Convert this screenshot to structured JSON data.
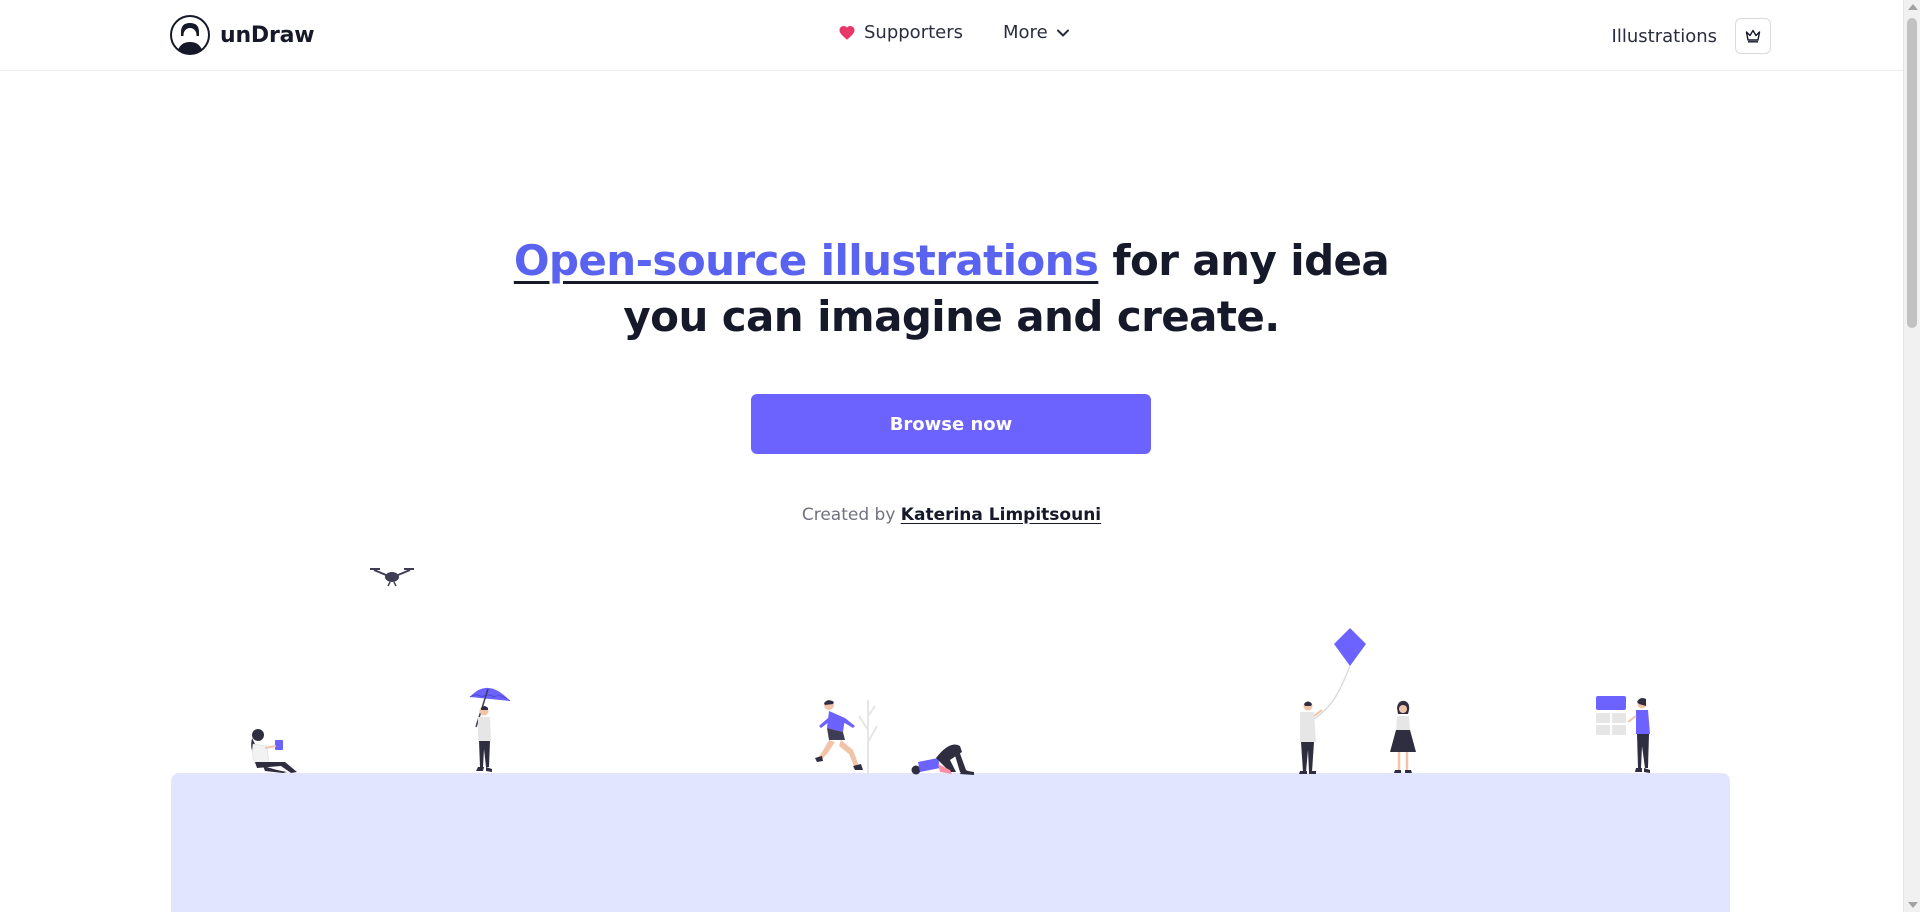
{
  "header": {
    "brand_name": "unDraw",
    "nav": {
      "supporters_label": "Supporters",
      "more_label": "More"
    },
    "illustrations_label": "Illustrations"
  },
  "hero": {
    "title_highlight": "Open-source illustrations",
    "title_rest_line1": " for any idea",
    "title_line2": "you can imagine and create.",
    "cta_label": "Browse now",
    "credit_prefix": "Created by ",
    "credit_author": "Katerina Limpitsouni"
  },
  "colors": {
    "accent": "#6c63ff",
    "ground": "#e1e5ff",
    "text_dark": "#16192a"
  },
  "icons": [
    "undraw-logo-icon",
    "heart-icon",
    "chevron-down-icon",
    "crown-icon"
  ]
}
